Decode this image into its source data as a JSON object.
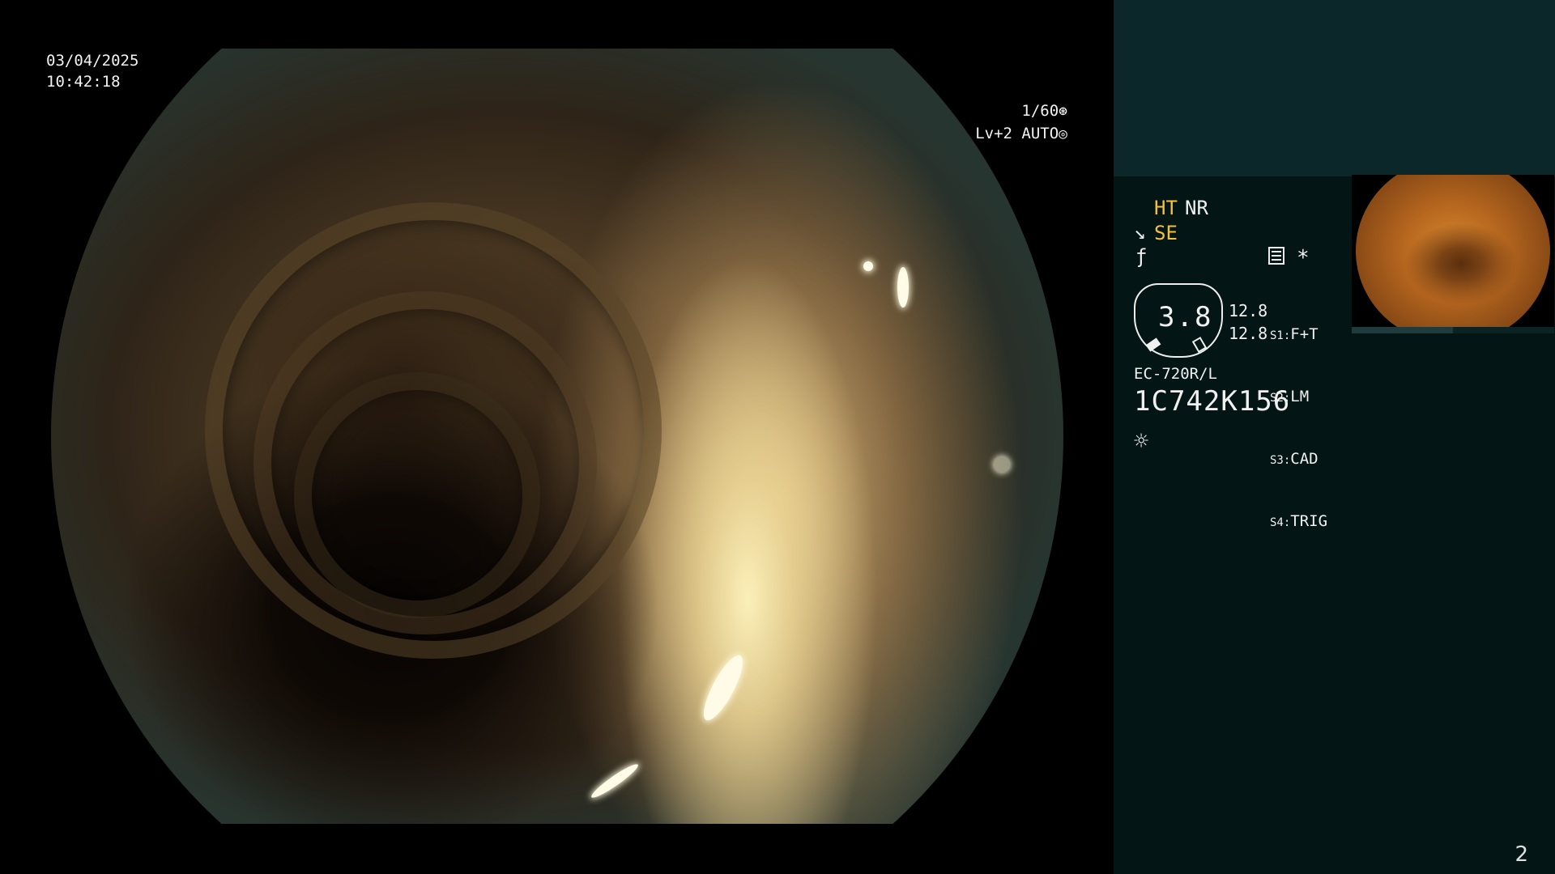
{
  "overlay": {
    "date": "03/04/2025",
    "time": "10:42:18",
    "shutter": "1/60",
    "shutter_icon": "shutter-icon",
    "level": "Lv+2 AUTO",
    "level_icon": "iris-icon"
  },
  "panel": {
    "ht": "HT",
    "nr": "NR",
    "se_icon": "↘",
    "se": "SE",
    "wave_icon": "ƒ",
    "doc_icon": "document-icon",
    "star": "*",
    "gauge_value": "3.8",
    "value_1": "12.8",
    "value_2": "12.8",
    "switches": [
      {
        "key": "S1:",
        "label": "F+T"
      },
      {
        "key": "S2:",
        "label": "LM"
      },
      {
        "key": "S3:",
        "label": "CAD"
      },
      {
        "key": "S4:",
        "label": "TRIG"
      }
    ],
    "model": "EC-720R/L",
    "serial": "1C742K156",
    "sun_icon": "☼"
  },
  "page_number": "2",
  "colors": {
    "accent_yellow": "#f3c235",
    "panel_bg": "#031615",
    "panel_top_bg": "#0c2729"
  }
}
